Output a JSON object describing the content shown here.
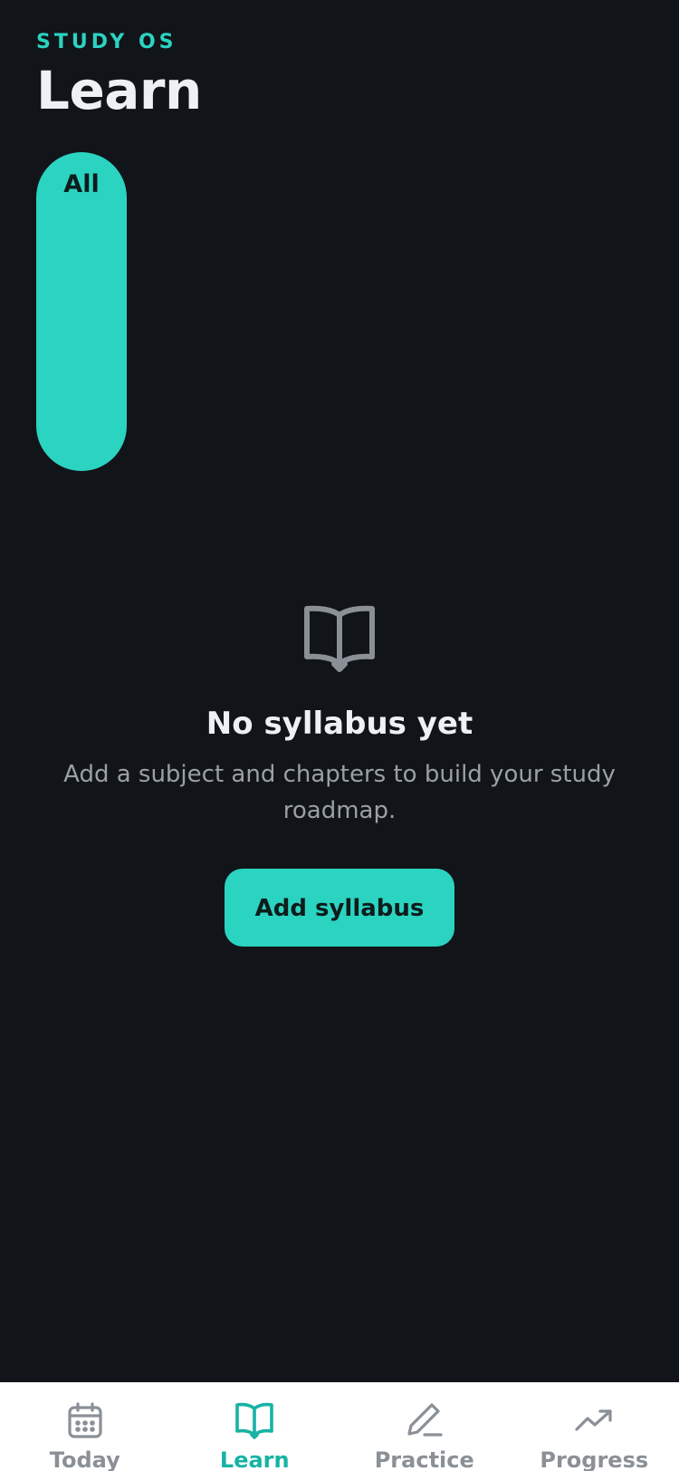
{
  "header": {
    "eyebrow": "STUDY OS",
    "title": "Learn"
  },
  "filters": [
    {
      "label": "All",
      "selected": true
    }
  ],
  "empty_state": {
    "icon": "open-book-icon",
    "title": "No syllabus yet",
    "description": "Add a subject and chapters to build your study roadmap.",
    "button_label": "Add syllabus"
  },
  "bottom_nav": {
    "items": [
      {
        "label": "Today",
        "icon": "calendar-icon",
        "active": false
      },
      {
        "label": "Learn",
        "icon": "book-icon",
        "active": true
      },
      {
        "label": "Practice",
        "icon": "pencil-icon",
        "active": false
      },
      {
        "label": "Progress",
        "icon": "trending-up-icon",
        "active": false
      }
    ]
  },
  "colors": {
    "background": "#111418",
    "accent": "#2bd3c1",
    "accent_active": "#17b3a4",
    "text_primary": "#eef1f4",
    "text_muted": "#9aa0a6",
    "nav_inactive": "#8b9096",
    "nav_background": "#ffffff"
  }
}
